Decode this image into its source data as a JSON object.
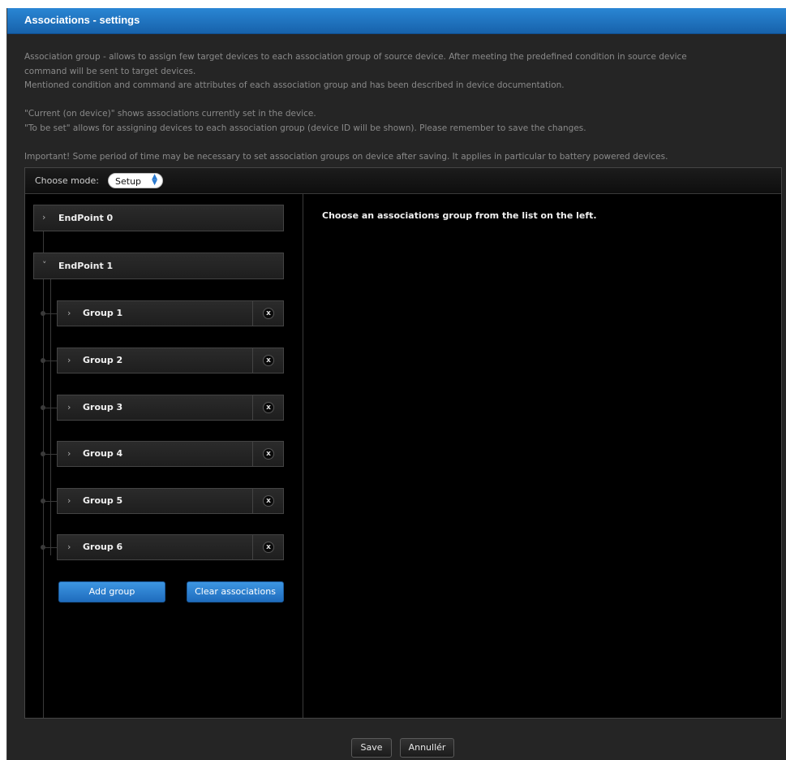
{
  "window": {
    "title": "Associations - settings"
  },
  "description": {
    "lines": [
      "Association group - allows to assign few target devices to each association group of source device. After meeting the predefined condition in source device",
      "command will be sent to target devices.",
      "Mentioned condition and command are attributes of each association group and has been described in device documentation.",
      "\"Current (on device)\" shows associations currently set in the device.",
      "\"To be set\" allows for assigning devices to each association group (device ID will be shown). Please remember to save the changes.",
      "Important! Some period of time may be necessary to set association groups on device after saving. It applies in particular to battery powered devices."
    ]
  },
  "mode": {
    "label": "Choose mode:",
    "selected": "Setup"
  },
  "endpoints": [
    {
      "label": "EndPoint 0",
      "chevron": "›",
      "expanded": false
    },
    {
      "label": "EndPoint 1",
      "chevron": "˅",
      "expanded": true
    }
  ],
  "groups": [
    {
      "label": "Group 1"
    },
    {
      "label": "Group 2"
    },
    {
      "label": "Group 3"
    },
    {
      "label": "Group 4"
    },
    {
      "label": "Group 5"
    },
    {
      "label": "Group 6"
    }
  ],
  "group_chevron": "›",
  "remove_glyph": "x",
  "actions": {
    "add_group": "Add group",
    "clear_associations": "Clear associations"
  },
  "right_message": "Choose an associations group from the list on the left.",
  "footer": {
    "save": "Save",
    "cancel": "Annullér"
  },
  "colors": {
    "title_bar": "#1f6fbf",
    "accent_button": "#2a7ad0",
    "panel_bg": "#000000",
    "dialog_bg": "#252525"
  }
}
